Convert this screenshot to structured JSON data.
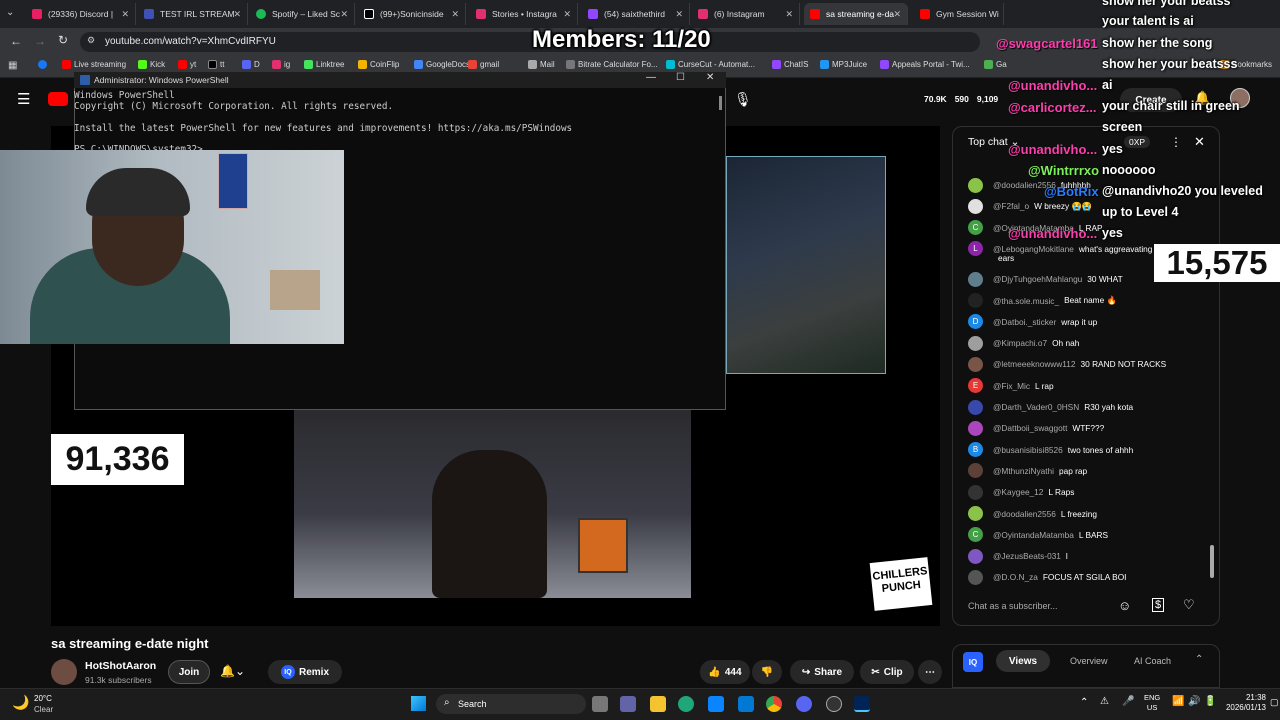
{
  "tabs": [
    {
      "label": "(29336) Discord |"
    },
    {
      "label": "TEST IRL STREAM"
    },
    {
      "label": "Spotify – Liked Sc"
    },
    {
      "label": "(99+)Sonicinside"
    },
    {
      "label": "Stories • Instagra"
    },
    {
      "label": "(54) saixthethird"
    },
    {
      "label": "(6) Instagram"
    },
    {
      "label": "sa streaming e-da"
    },
    {
      "label": "Gym Session Wi"
    }
  ],
  "address": "youtube.com/watch?v=XhmCvdIRFYU",
  "bookmarks": [
    "Live streaming",
    "Kick",
    "yt",
    "tt",
    "D",
    "ig",
    "Linktree",
    "CoinFlip",
    "GoogleDocs",
    "gmail",
    "Mail",
    "Bitrate Calculator Fo...",
    "CurseCut - Automat...",
    "ChatIS",
    "MP3Juice",
    "Appeals Portal - Twi...",
    "Ga",
    "Bookmarks"
  ],
  "powershell": {
    "title": "Administrator: Windows PowerShell",
    "lines": [
      "Windows PowerShell",
      "Copyright (C) Microsoft Corporation. All rights reserved.",
      "",
      "Install the latest PowerShell for new features and improvements! https://aka.ms/PSWindows",
      "",
      "PS C:\\WINDOWS\\system32>"
    ]
  },
  "overlay": {
    "members": "Members: 11/20",
    "counter_left": "91,336",
    "counter_right": "15,575",
    "floating_names": [
      "@swagcartel161",
      "@unandivho...",
      "@carlicortez...",
      "@unandivho...",
      "@Wintrrrxo",
      "@BotRix",
      "@unandivho..."
    ],
    "floating_msgs": [
      "show her your beatss",
      "your talent is ai",
      "show her the song",
      "show her your beatsss",
      "ai",
      "your chair still in green",
      "screen",
      "yes",
      "noooooo",
      "@unandivho20 you leveled",
      "up to Level 4",
      "yes"
    ]
  },
  "youtube": {
    "stats": {
      "views": "70.9K",
      "likes": "590",
      "other": "9,109"
    },
    "create_label": "Create",
    "video_title": "sa streaming e-date night",
    "channel": "HotShotAaron",
    "subscribers": "91.3k subscribers",
    "join": "Join",
    "remix": "Remix",
    "like_count": "444",
    "share": "Share",
    "clip": "Clip",
    "chat_header": "Top chat",
    "xp_badge": "0XP",
    "chat_placeholder": "Chat as a subscriber...",
    "tabs": [
      "Views",
      "Overview",
      "AI Coach"
    ],
    "brand_sticker": "CHILLERS PUNCH"
  },
  "chat": [
    {
      "user": "@doodalien2556",
      "msg": "fuhhhhh",
      "color": "#8bc34a",
      "letter": ""
    },
    {
      "user": "@F2fal_o",
      "msg": "W breezy 😭😭",
      "color": "#e0e0e0",
      "letter": ""
    },
    {
      "user": "@OyintandaMatamba",
      "msg": "L RAP",
      "color": "#43a047",
      "letter": "C"
    },
    {
      "user": "@LebogangMokitlane",
      "msg": "what's aggreavating my",
      "color": "#8e24aa",
      "letter": "L"
    },
    {
      "user": "",
      "msg": "ears",
      "color": "",
      "letter": ""
    },
    {
      "user": "@DjyTuhgoehMahlangu",
      "msg": "30 WHAT",
      "color": "#607d8b",
      "letter": ""
    },
    {
      "user": "@tha.sole.music_",
      "msg": "Beat name 🔥",
      "color": "#222",
      "letter": ""
    },
    {
      "user": "@Datboi._sticker",
      "msg": "wrap it up",
      "color": "#1e88e5",
      "letter": "D"
    },
    {
      "user": "@Kimpachi.o7",
      "msg": "Oh nah",
      "color": "#9e9e9e",
      "letter": ""
    },
    {
      "user": "@letmeeeknowww112",
      "msg": "30 RAND NOT RACKS",
      "color": "#795548",
      "letter": ""
    },
    {
      "user": "@Fix_Mic",
      "msg": "L rap",
      "color": "#e53935",
      "letter": "E"
    },
    {
      "user": "@Darth_Vader0_0HSN",
      "msg": "R30 yah kota",
      "color": "#3949ab",
      "letter": ""
    },
    {
      "user": "@Dattboii_swaggott",
      "msg": "WTF???",
      "color": "#ab47bc",
      "letter": ""
    },
    {
      "user": "@busanisibisi8526",
      "msg": "two tones of ahhh",
      "color": "#1e88e5",
      "letter": "B"
    },
    {
      "user": "@MthunziNyathi",
      "msg": "pap rap",
      "color": "#5d4037",
      "letter": ""
    },
    {
      "user": "@Kaygee_12",
      "msg": "L Raps",
      "color": "#333",
      "letter": ""
    },
    {
      "user": "@doodalien2556",
      "msg": "L freezing",
      "color": "#8bc34a",
      "letter": ""
    },
    {
      "user": "@OyintandaMatamba",
      "msg": "L BARS",
      "color": "#43a047",
      "letter": "C"
    },
    {
      "user": "@JezusBeats-031",
      "msg": "l",
      "color": "#7e57c2",
      "letter": ""
    },
    {
      "user": "@D.O.N_za",
      "msg": "FOCUS AT SGILA BOI",
      "color": "#555",
      "letter": ""
    }
  ],
  "taskbar": {
    "weather_temp": "20°C",
    "weather_desc": "Clear",
    "search": "Search",
    "lang": "ENG",
    "region": "US",
    "time": "21:38",
    "date": "2026/01/13"
  }
}
